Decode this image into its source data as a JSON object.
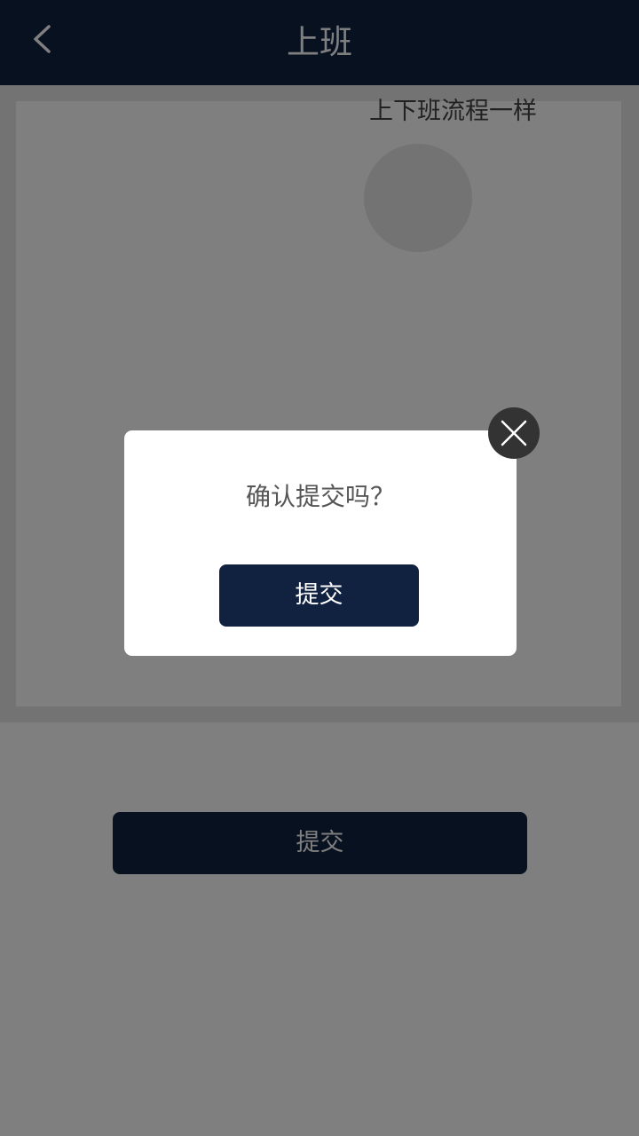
{
  "header": {
    "title": "上班",
    "back_icon": "chevron-left-icon"
  },
  "photo": {
    "note": "上下班流程一样",
    "placeholder_icon": "image-placeholder-icon"
  },
  "main": {
    "submit_label": "提交"
  },
  "dialog": {
    "message": "确认提交吗？",
    "submit_label": "提交",
    "close_icon": "close-icon"
  },
  "colors": {
    "header_bg": "#112240",
    "button_bg": "#112240",
    "overlay": "rgba(0,0,0,0.5)",
    "close_button_bg": "#333333"
  }
}
